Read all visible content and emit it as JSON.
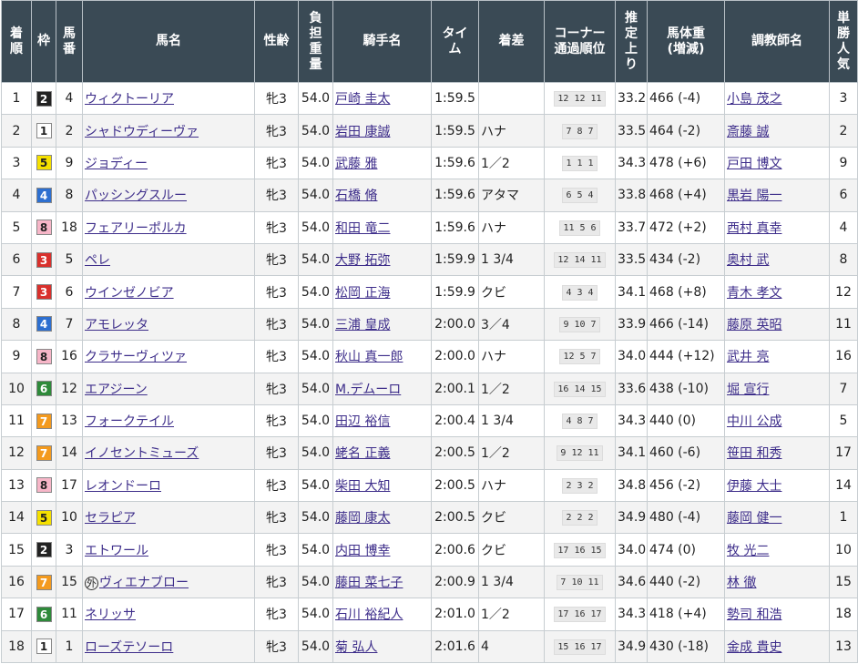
{
  "headers": [
    "着順",
    "枠",
    "馬番",
    "馬名",
    "性齢",
    "負担重量",
    "騎手名",
    "タイム",
    "着差",
    "コーナー通過順位",
    "推定上り",
    "馬体重(増減)",
    "調教師名",
    "単勝人気"
  ],
  "header_lines": [
    [
      "着",
      "順"
    ],
    [
      "枠"
    ],
    [
      "馬",
      "番"
    ],
    [
      "馬名"
    ],
    [
      "性齢"
    ],
    [
      "負",
      "担",
      "重",
      "量"
    ],
    [
      "騎手名"
    ],
    [
      "タイ",
      "ム"
    ],
    [
      "着差"
    ],
    [
      "コーナー",
      "通過順位"
    ],
    [
      "推",
      "定",
      "上",
      "り"
    ],
    [
      "馬体重",
      "(増減)"
    ],
    [
      "調教師名"
    ],
    [
      "単",
      "勝",
      "人",
      "気"
    ]
  ],
  "waku_colors": {
    "1": {
      "bg": "#ffffff",
      "fg": "#222222"
    },
    "2": {
      "bg": "#222222",
      "fg": "#ffffff"
    },
    "3": {
      "bg": "#d9302c",
      "fg": "#ffffff"
    },
    "4": {
      "bg": "#2d6fd0",
      "fg": "#ffffff"
    },
    "5": {
      "bg": "#f5e000",
      "fg": "#222222"
    },
    "6": {
      "bg": "#2e8a3a",
      "fg": "#ffffff"
    },
    "7": {
      "bg": "#f39a1e",
      "fg": "#ffffff"
    },
    "8": {
      "bg": "#f7b6c8",
      "fg": "#222222"
    }
  },
  "rows": [
    {
      "rank": "1",
      "waku": "2",
      "num": "4",
      "horse": "ウィクトーリア",
      "mark": "",
      "sexage": "牝3",
      "weight": "54.0",
      "jockey": "戸崎 圭太",
      "time": "1:59.5",
      "margin": "",
      "corner": "12 12 11",
      "last3f": "33.2",
      "body": "466 (-4)",
      "trainer": "小島 茂之",
      "pop": "3"
    },
    {
      "rank": "2",
      "waku": "1",
      "num": "2",
      "horse": "シャドウディーヴァ",
      "mark": "",
      "sexage": "牝3",
      "weight": "54.0",
      "jockey": "岩田 康誠",
      "time": "1:59.5",
      "margin": "ハナ",
      "corner": "7 8 7",
      "last3f": "33.5",
      "body": "464 (-2)",
      "trainer": "斎藤 誠",
      "pop": "2"
    },
    {
      "rank": "3",
      "waku": "5",
      "num": "9",
      "horse": "ジョディー",
      "mark": "",
      "sexage": "牝3",
      "weight": "54.0",
      "jockey": "武藤 雅",
      "time": "1:59.6",
      "margin": "1／2",
      "corner": "1 1 1",
      "last3f": "34.3",
      "body": "478 (+6)",
      "trainer": "戸田 博文",
      "pop": "9"
    },
    {
      "rank": "4",
      "waku": "4",
      "num": "8",
      "horse": "パッシングスルー",
      "mark": "",
      "sexage": "牝3",
      "weight": "54.0",
      "jockey": "石橋 脩",
      "time": "1:59.6",
      "margin": "アタマ",
      "corner": "6 5 4",
      "last3f": "33.8",
      "body": "468 (+4)",
      "trainer": "黒岩 陽一",
      "pop": "6"
    },
    {
      "rank": "5",
      "waku": "8",
      "num": "18",
      "horse": "フェアリーポルカ",
      "mark": "",
      "sexage": "牝3",
      "weight": "54.0",
      "jockey": "和田 竜二",
      "time": "1:59.6",
      "margin": "ハナ",
      "corner": "11 5 6",
      "last3f": "33.7",
      "body": "472 (+2)",
      "trainer": "西村 真幸",
      "pop": "4"
    },
    {
      "rank": "6",
      "waku": "3",
      "num": "5",
      "horse": "ペレ",
      "mark": "",
      "sexage": "牝3",
      "weight": "54.0",
      "jockey": "大野 拓弥",
      "time": "1:59.9",
      "margin": "1 3/4",
      "corner": "12 14 11",
      "last3f": "33.5",
      "body": "434 (-2)",
      "trainer": "奥村 武",
      "pop": "8"
    },
    {
      "rank": "7",
      "waku": "3",
      "num": "6",
      "horse": "ウインゼノビア",
      "mark": "",
      "sexage": "牝3",
      "weight": "54.0",
      "jockey": "松岡 正海",
      "time": "1:59.9",
      "margin": "クビ",
      "corner": "4 3 4",
      "last3f": "34.1",
      "body": "468 (+8)",
      "trainer": "青木 孝文",
      "pop": "12"
    },
    {
      "rank": "8",
      "waku": "4",
      "num": "7",
      "horse": "アモレッタ",
      "mark": "",
      "sexage": "牝3",
      "weight": "54.0",
      "jockey": "三浦 皇成",
      "time": "2:00.0",
      "margin": "3／4",
      "corner": "9 10 7",
      "last3f": "33.9",
      "body": "466 (-14)",
      "trainer": "藤原 英昭",
      "pop": "11"
    },
    {
      "rank": "9",
      "waku": "8",
      "num": "16",
      "horse": "クラサーヴィツァ",
      "mark": "",
      "sexage": "牝3",
      "weight": "54.0",
      "jockey": "秋山 真一郎",
      "time": "2:00.0",
      "margin": "ハナ",
      "corner": "12 5 7",
      "last3f": "34.0",
      "body": "444 (+12)",
      "trainer": "武井 亮",
      "pop": "16"
    },
    {
      "rank": "10",
      "waku": "6",
      "num": "12",
      "horse": "エアジーン",
      "mark": "",
      "sexage": "牝3",
      "weight": "54.0",
      "jockey": "M.デムーロ",
      "time": "2:00.1",
      "margin": "1／2",
      "corner": "16 14 15",
      "last3f": "33.6",
      "body": "438 (-10)",
      "trainer": "堀 宣行",
      "pop": "7"
    },
    {
      "rank": "11",
      "waku": "7",
      "num": "13",
      "horse": "フォークテイル",
      "mark": "",
      "sexage": "牝3",
      "weight": "54.0",
      "jockey": "田辺 裕信",
      "time": "2:00.4",
      "margin": "1 3/4",
      "corner": "4 8 7",
      "last3f": "34.3",
      "body": "440 (0)",
      "trainer": "中川 公成",
      "pop": "5"
    },
    {
      "rank": "12",
      "waku": "7",
      "num": "14",
      "horse": "イノセントミューズ",
      "mark": "",
      "sexage": "牝3",
      "weight": "54.0",
      "jockey": "蛯名 正義",
      "time": "2:00.5",
      "margin": "1／2",
      "corner": "9 12 11",
      "last3f": "34.1",
      "body": "460 (-6)",
      "trainer": "笹田 和秀",
      "pop": "17"
    },
    {
      "rank": "13",
      "waku": "8",
      "num": "17",
      "horse": "レオンドーロ",
      "mark": "",
      "sexage": "牝3",
      "weight": "54.0",
      "jockey": "柴田 大知",
      "time": "2:00.5",
      "margin": "ハナ",
      "corner": "2 3 2",
      "last3f": "34.8",
      "body": "456 (-2)",
      "trainer": "伊藤 大士",
      "pop": "14"
    },
    {
      "rank": "14",
      "waku": "5",
      "num": "10",
      "horse": "セラピア",
      "mark": "",
      "sexage": "牝3",
      "weight": "54.0",
      "jockey": "藤岡 康太",
      "time": "2:00.5",
      "margin": "クビ",
      "corner": "2 2 2",
      "last3f": "34.9",
      "body": "480 (-4)",
      "trainer": "藤岡 健一",
      "pop": "1"
    },
    {
      "rank": "15",
      "waku": "2",
      "num": "3",
      "horse": "エトワール",
      "mark": "",
      "sexage": "牝3",
      "weight": "54.0",
      "jockey": "内田 博幸",
      "time": "2:00.6",
      "margin": "クビ",
      "corner": "17 16 15",
      "last3f": "34.0",
      "body": "474 (0)",
      "trainer": "牧 光二",
      "pop": "10"
    },
    {
      "rank": "16",
      "waku": "7",
      "num": "15",
      "horse": "ヴィエナブロー",
      "mark": "外",
      "sexage": "牝3",
      "weight": "54.0",
      "jockey": "藤田 菜七子",
      "time": "2:00.9",
      "margin": "1 3/4",
      "corner": "7 10 11",
      "last3f": "34.6",
      "body": "440 (-2)",
      "trainer": "林 徹",
      "pop": "15"
    },
    {
      "rank": "17",
      "waku": "6",
      "num": "11",
      "horse": "ネリッサ",
      "mark": "",
      "sexage": "牝3",
      "weight": "54.0",
      "jockey": "石川 裕紀人",
      "time": "2:01.0",
      "margin": "1／2",
      "corner": "17 16 17",
      "last3f": "34.3",
      "body": "418 (+4)",
      "trainer": "勢司 和浩",
      "pop": "18"
    },
    {
      "rank": "18",
      "waku": "1",
      "num": "1",
      "horse": "ローズテソーロ",
      "mark": "",
      "sexage": "牝3",
      "weight": "54.0",
      "jockey": "菊 弘人",
      "time": "2:01.6",
      "margin": "4",
      "corner": "15 16 17",
      "last3f": "34.9",
      "body": "430 (-18)",
      "trainer": "金成 貴史",
      "pop": "13"
    }
  ]
}
